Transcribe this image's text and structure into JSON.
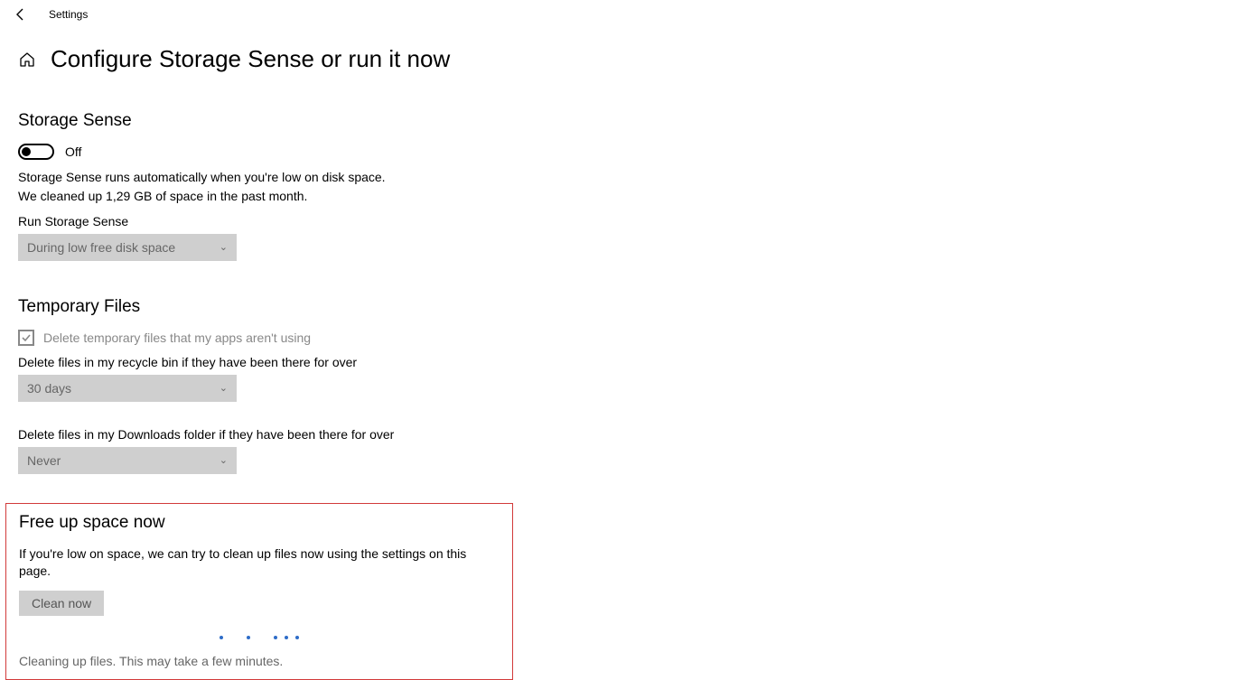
{
  "app_title": "Settings",
  "page_title": "Configure Storage Sense or run it now",
  "storage_sense": {
    "heading": "Storage Sense",
    "toggle_state": "Off",
    "desc_line1": "Storage Sense runs automatically when you're low on disk space.",
    "desc_line2": "We cleaned up 1,29 GB of space in the past month.",
    "run_label": "Run Storage Sense",
    "run_value": "During low free disk space"
  },
  "temp_files": {
    "heading": "Temporary Files",
    "checkbox_label": "Delete temporary files that my apps aren't using",
    "recycle_label": "Delete files in my recycle bin if they have been there for over",
    "recycle_value": "30 days",
    "downloads_label": "Delete files in my Downloads folder if they have been there for over",
    "downloads_value": "Never"
  },
  "free_up": {
    "heading": "Free up space now",
    "desc": "If you're low on space, we can try to clean up files now using the settings on this page.",
    "button": "Clean now",
    "status": "Cleaning up files. This may take a few minutes."
  }
}
